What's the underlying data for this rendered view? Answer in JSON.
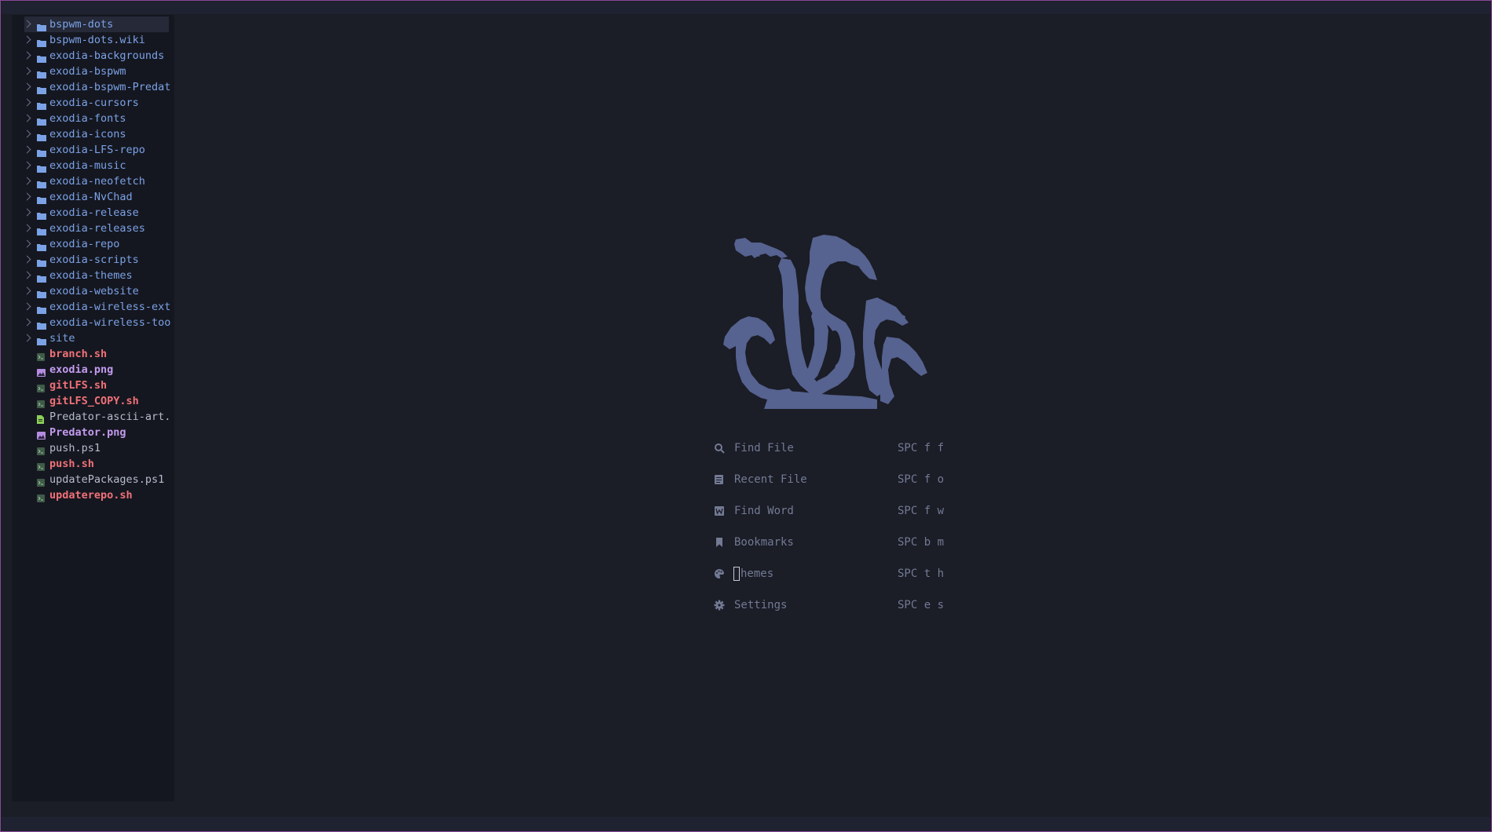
{
  "colors": {
    "background": "#1b1d27",
    "sidebar": "#151720",
    "folder": "#7ba2e6",
    "script": "#f07178",
    "image": "#c49bf0",
    "text": "#b6bbcb",
    "logo": "#56628f",
    "border": "#8a4a9a"
  },
  "tree": {
    "folders": [
      {
        "name": "bspwm-dots",
        "icon": "folder-icon"
      },
      {
        "name": "bspwm-dots.wiki",
        "icon": "folder-icon"
      },
      {
        "name": "exodia-backgrounds",
        "icon": "folder-icon"
      },
      {
        "name": "exodia-bspwm",
        "icon": "folder-icon"
      },
      {
        "name": "exodia-bspwm-Predat",
        "icon": "folder-icon"
      },
      {
        "name": "exodia-cursors",
        "icon": "folder-icon"
      },
      {
        "name": "exodia-fonts",
        "icon": "folder-icon"
      },
      {
        "name": "exodia-icons",
        "icon": "folder-icon"
      },
      {
        "name": "exodia-LFS-repo",
        "icon": "folder-icon"
      },
      {
        "name": "exodia-music",
        "icon": "folder-icon"
      },
      {
        "name": "exodia-neofetch",
        "icon": "folder-icon"
      },
      {
        "name": "exodia-NvChad",
        "icon": "folder-icon"
      },
      {
        "name": "exodia-release",
        "icon": "folder-icon"
      },
      {
        "name": "exodia-releases",
        "icon": "folder-icon"
      },
      {
        "name": "exodia-repo",
        "icon": "folder-icon"
      },
      {
        "name": "exodia-scripts",
        "icon": "folder-icon"
      },
      {
        "name": "exodia-themes",
        "icon": "folder-icon"
      },
      {
        "name": "exodia-website",
        "icon": "folder-icon"
      },
      {
        "name": "exodia-wireless-ext",
        "icon": "folder-icon"
      },
      {
        "name": "exodia-wireless-too",
        "icon": "folder-icon"
      },
      {
        "name": "site",
        "icon": "folder-icon"
      }
    ],
    "files": [
      {
        "name": "branch.sh",
        "kind": "sh",
        "icon": "terminal-file-icon"
      },
      {
        "name": "exodia.png",
        "kind": "png",
        "icon": "image-file-icon"
      },
      {
        "name": "gitLFS.sh",
        "kind": "sh",
        "icon": "terminal-file-icon"
      },
      {
        "name": "gitLFS_COPY.sh",
        "kind": "sh",
        "icon": "terminal-file-icon"
      },
      {
        "name": "Predator-ascii-art.",
        "kind": "txt",
        "icon": "text-file-icon"
      },
      {
        "name": "Predator.png",
        "kind": "png",
        "icon": "image-file-icon"
      },
      {
        "name": "push.ps1",
        "kind": "ps1",
        "icon": "terminal-file-icon"
      },
      {
        "name": "push.sh",
        "kind": "sh",
        "icon": "terminal-file-icon"
      },
      {
        "name": "updatePackages.ps1",
        "kind": "ps1",
        "icon": "terminal-file-icon"
      },
      {
        "name": "updaterepo.sh",
        "kind": "sh",
        "icon": "terminal-file-icon"
      }
    ]
  },
  "dashboard": {
    "logo": "hydra-dragon-logo",
    "menu": [
      {
        "label": "Find File",
        "key": "SPC f f",
        "icon": "search-icon"
      },
      {
        "label": "Recent File",
        "key": "SPC f o",
        "icon": "file-list-icon"
      },
      {
        "label": "Find Word",
        "key": "SPC f w",
        "icon": "word-icon"
      },
      {
        "label": "Bookmarks",
        "key": "SPC b m",
        "icon": "bookmark-icon"
      },
      {
        "label": "hemes",
        "key": "SPC t h",
        "icon": "palette-icon"
      },
      {
        "label": "Settings",
        "key": "SPC e s",
        "icon": "gear-icon"
      }
    ]
  }
}
